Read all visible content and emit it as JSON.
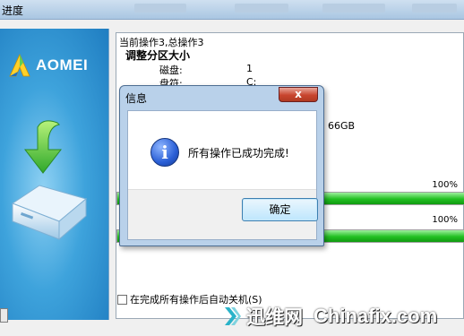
{
  "window": {
    "title": "进度"
  },
  "brand": {
    "name": "AOMEI"
  },
  "operations": {
    "progress_text": "当前操作3,总操作3",
    "current_op": "调整分区大小",
    "details": [
      {
        "label": "磁盘:",
        "value": "1"
      },
      {
        "label": "盘符:",
        "value": "C:"
      }
    ],
    "size_fragment": "66GB"
  },
  "progress": {
    "current_percent_label": "100%",
    "current_fraction": 1.0,
    "total_percent_label": "100%",
    "total_fraction": 1.0
  },
  "shutdown_option": {
    "label": "在完成所有操作后自动关机(S)",
    "checked": false
  },
  "dialog": {
    "title": "信息",
    "message": "所有操作已成功完成!",
    "ok_label": "确定",
    "close_glyph": "x"
  },
  "watermark": {
    "cn": "迅维网",
    "en": "Chinafix.com"
  },
  "colors": {
    "progress_fill": "#22c022",
    "dialog_frame": "#b9d1ea",
    "close_red": "#c8452f"
  }
}
